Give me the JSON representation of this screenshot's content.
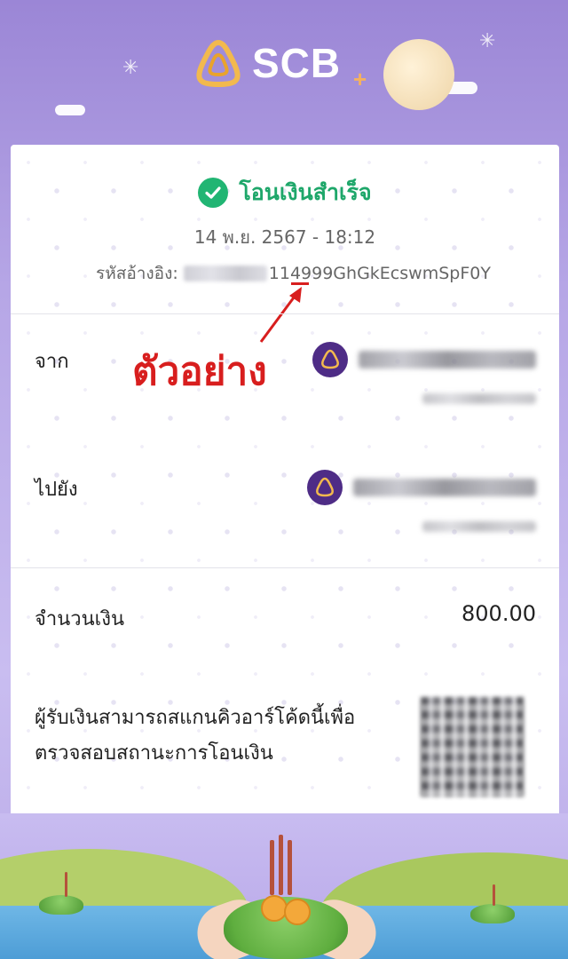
{
  "brand": {
    "name": "SCB",
    "plus": "+"
  },
  "receipt": {
    "status": "โอนเงินสำเร็จ",
    "datetime": "14 พ.ย. 2567 - 18:12",
    "ref_label": "รหัสอ้างอิง:",
    "ref_visible": "114999GhGkEcswmSpF0Y",
    "annotation": "ตัวอย่าง",
    "from_label": "จาก",
    "to_label": "ไปยัง",
    "amount_label": "จำนวนเงิน",
    "amount": "800.00",
    "qr_note_line1": "ผู้รับเงินสามารถสแกนคิวอาร์โค้ดนี้เพื่อ",
    "qr_note_line2": "ตรวจสอบสถานะการโอนเงิน"
  },
  "colors": {
    "success": "#21b573",
    "brand_purple": "#4e2c86",
    "annotation_red": "#d81e1e"
  },
  "icons": {
    "status": "check-circle-icon",
    "bank": "scb-logo-icon"
  }
}
